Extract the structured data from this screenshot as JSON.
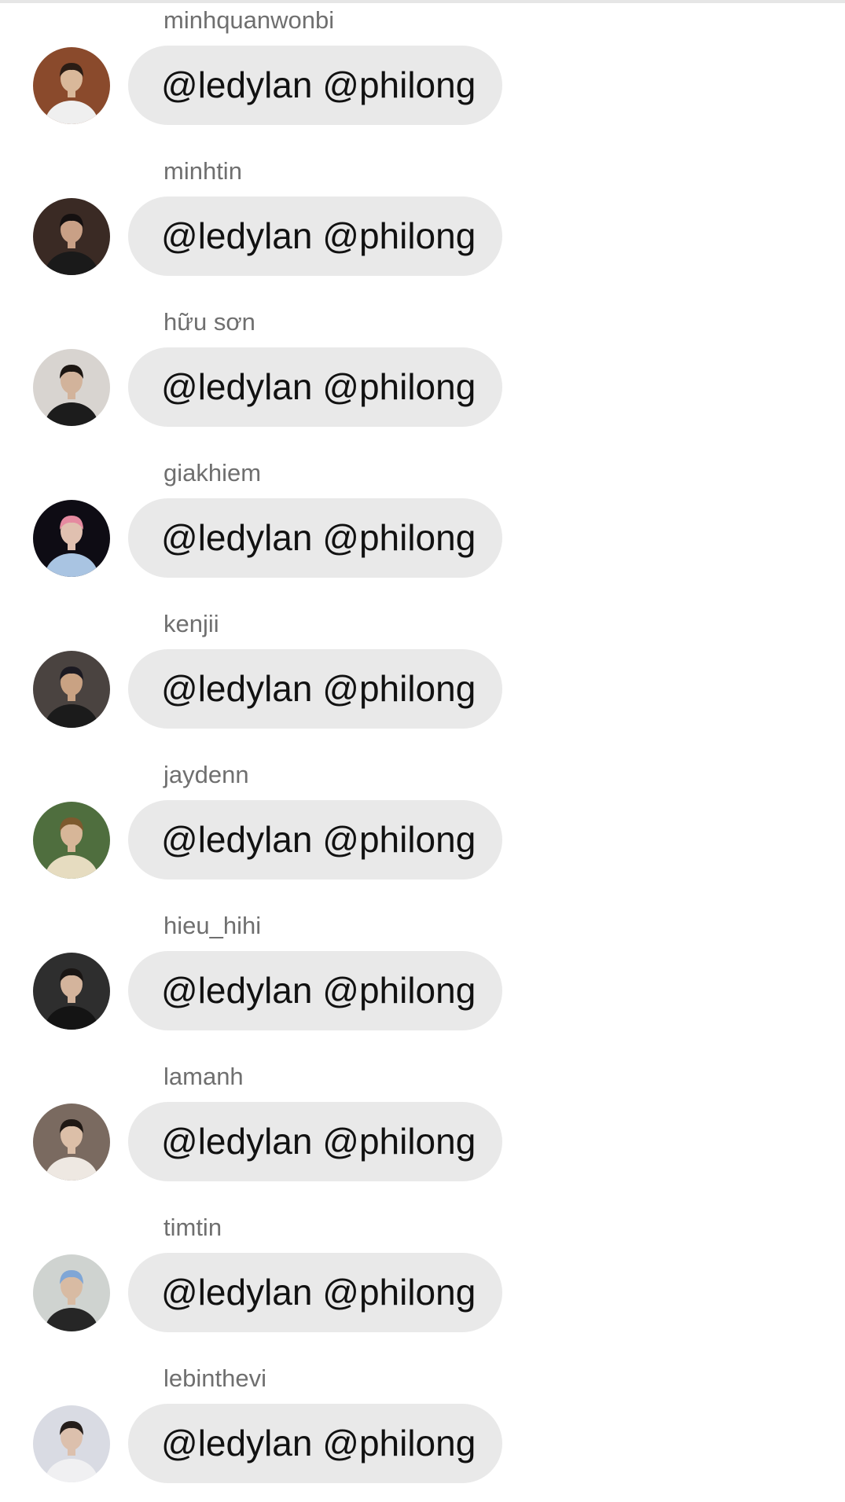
{
  "messages": [
    {
      "sender": "minhquanwonbi",
      "text": "@ledylan @philong",
      "avatar": {
        "bg": "#8a4a2c",
        "shirt": "#efefef",
        "skin": "#d9b89a",
        "hair": "#2a1c14"
      }
    },
    {
      "sender": "minhtin",
      "text": "@ledylan @philong",
      "avatar": {
        "bg": "#3a2a24",
        "shirt": "#1a1a1a",
        "skin": "#c9a086",
        "hair": "#151010"
      }
    },
    {
      "sender": "hữu sơn",
      "text": "@ledylan @philong",
      "avatar": {
        "bg": "#d8d4d0",
        "shirt": "#1c1c1c",
        "skin": "#d2b39b",
        "hair": "#1c1612"
      }
    },
    {
      "sender": "giakhiem",
      "text": "@ledylan @philong",
      "avatar": {
        "bg": "#0e0c14",
        "shirt": "#a9c4e2",
        "skin": "#e0c0b0",
        "hair": "#e58aa0"
      }
    },
    {
      "sender": "kenjii",
      "text": "@ledylan @philong",
      "avatar": {
        "bg": "#4a4340",
        "shirt": "#1b1b1b",
        "skin": "#c9a283",
        "hair": "#1c1a22"
      }
    },
    {
      "sender": "jaydenn",
      "text": "@ledylan @philong",
      "avatar": {
        "bg": "#4f6e3e",
        "shirt": "#e6dcc0",
        "skin": "#d7b698",
        "hair": "#7d5a2e"
      }
    },
    {
      "sender": "hieu_hihi",
      "text": "@ledylan @philong",
      "avatar": {
        "bg": "#2e2e2e",
        "shirt": "#141414",
        "skin": "#d4b49c",
        "hair": "#1a1614"
      }
    },
    {
      "sender": "lamanh",
      "text": "@ledylan @philong",
      "avatar": {
        "bg": "#7a6a60",
        "shirt": "#eee8e2",
        "skin": "#dcbfa8",
        "hair": "#1f1814"
      }
    },
    {
      "sender": "timtin",
      "text": "@ledylan @philong",
      "avatar": {
        "bg": "#cfd3d0",
        "shirt": "#262626",
        "skin": "#d8bba3",
        "hair": "#7fa6d6"
      }
    },
    {
      "sender": "lebinthevi",
      "text": "@ledylan @philong",
      "avatar": {
        "bg": "#d9dbe3",
        "shirt": "#f0f0f2",
        "skin": "#dcc0ad",
        "hair": "#241d1a"
      }
    }
  ]
}
